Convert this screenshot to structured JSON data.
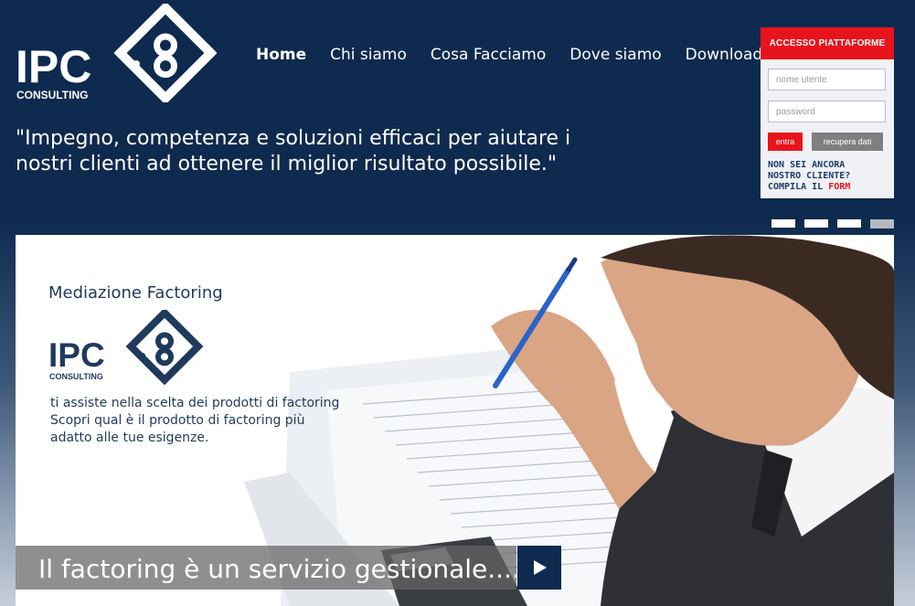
{
  "brand": {
    "name": "IPC",
    "sub": "CONSULTING"
  },
  "nav": {
    "items": [
      "Home",
      "Chi siamo",
      "Cosa Facciamo",
      "Dove siamo",
      "Download"
    ],
    "active": "Home"
  },
  "tagline": {
    "line1": "\"Impegno, competenza e soluzioni efficaci per aiutare i",
    "line2": "nostri clienti ad ottenere il miglior risultato possibile.\""
  },
  "login": {
    "title": "ACCESSO PIATTAFORME",
    "username_placeholder": "nome utente",
    "password_placeholder": "password",
    "enter_label": "entra",
    "recover_label": "recupera dati",
    "note_line1": "NON SEI ANCORA",
    "note_line2": "NOSTRO CLIENTE?",
    "note_line3": "COMPILA IL ",
    "note_form": "FORM"
  },
  "slider": {
    "slide_count": 4,
    "active_slide": 4
  },
  "banner": {
    "title": "Mediazione Factoring",
    "text_line1": "ti assiste nella scelta dei prodotti di factoring",
    "text_line2": "Scopri qual è il prodotto di factoring più",
    "text_line3": "adatto alle tue esigenze.",
    "caption": "Il factoring è un servizio gestionale...."
  },
  "colors": {
    "navy": "#0e2a4f",
    "red": "#e8141c",
    "banner_text": "#1f3a5c"
  },
  "icons": [
    "ipc-logo-icon",
    "play-icon"
  ]
}
